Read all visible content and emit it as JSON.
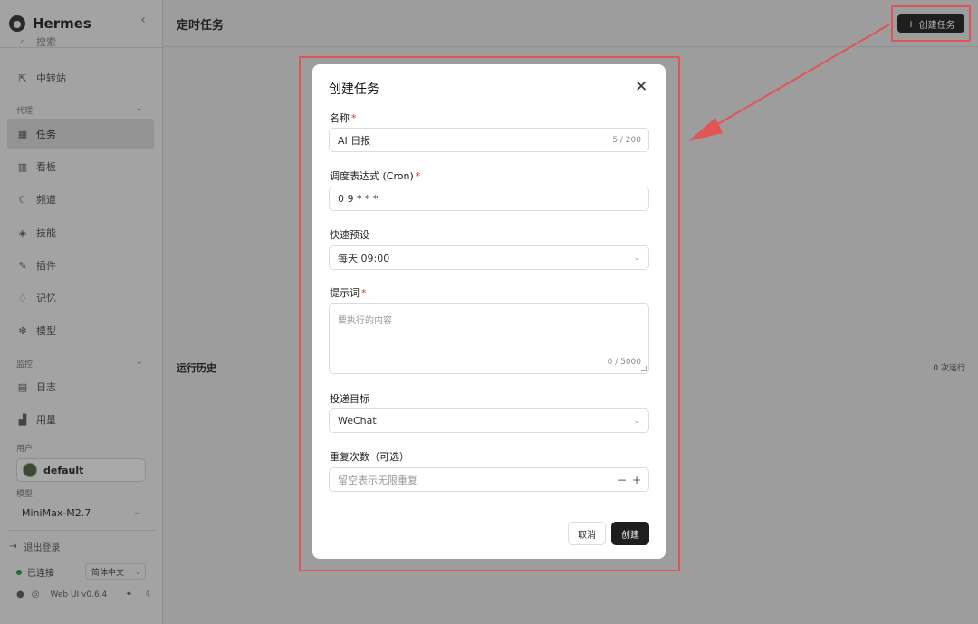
{
  "app": {
    "brand": "Hermes",
    "collapse_icon": "chevron-left-icon"
  },
  "sidebar": {
    "items_top": [
      {
        "label": "搜索",
        "icon": "search-icon"
      },
      {
        "label": "中转站",
        "icon": "external-link-icon"
      }
    ],
    "section_agent": "代理",
    "items_agent": [
      {
        "label": "任务",
        "icon": "calendar-icon",
        "active": true
      },
      {
        "label": "看板",
        "icon": "board-icon"
      },
      {
        "label": "频道",
        "icon": "moon-icon"
      },
      {
        "label": "技能",
        "icon": "layers-icon"
      },
      {
        "label": "插件",
        "icon": "wrench-icon"
      },
      {
        "label": "记忆",
        "icon": "bulb-icon"
      },
      {
        "label": "模型",
        "icon": "sparkle-icon"
      }
    ],
    "section_monitor": "监控",
    "items_monitor": [
      {
        "label": "日志",
        "icon": "document-icon"
      },
      {
        "label": "用量",
        "icon": "bar-chart-icon"
      }
    ],
    "section_user": "用户",
    "user_name": "default",
    "section_model": "模型",
    "model_value": "MiniMax-M2.7",
    "logout": "退出登录",
    "status": "已连接",
    "language": "简体中文",
    "version": "Web UI v0.6.4"
  },
  "main": {
    "title": "定时任务",
    "create_button": "创建任务",
    "history_title": "运行历史",
    "history_count": "0 次运行"
  },
  "modal": {
    "title": "创建任务",
    "name_label": "名称",
    "name_value": "AI 日报",
    "name_count": "5 / 200",
    "cron_label": "调度表达式 (Cron)",
    "cron_value": "0 9 * * *",
    "preset_label": "快速预设",
    "preset_value": "每天 09:00",
    "prompt_label": "提示词",
    "prompt_placeholder": "要执行的内容",
    "prompt_count": "0 / 5000",
    "target_label": "投递目标",
    "target_value": "WeChat",
    "repeat_label": "重复次数（可选）",
    "repeat_placeholder": "留空表示无限重复",
    "cancel": "取消",
    "create": "创建"
  },
  "colors": {
    "highlight": "#e05555",
    "primary_button": "#1e1e1e",
    "status_dot": "#1e6f3a"
  }
}
